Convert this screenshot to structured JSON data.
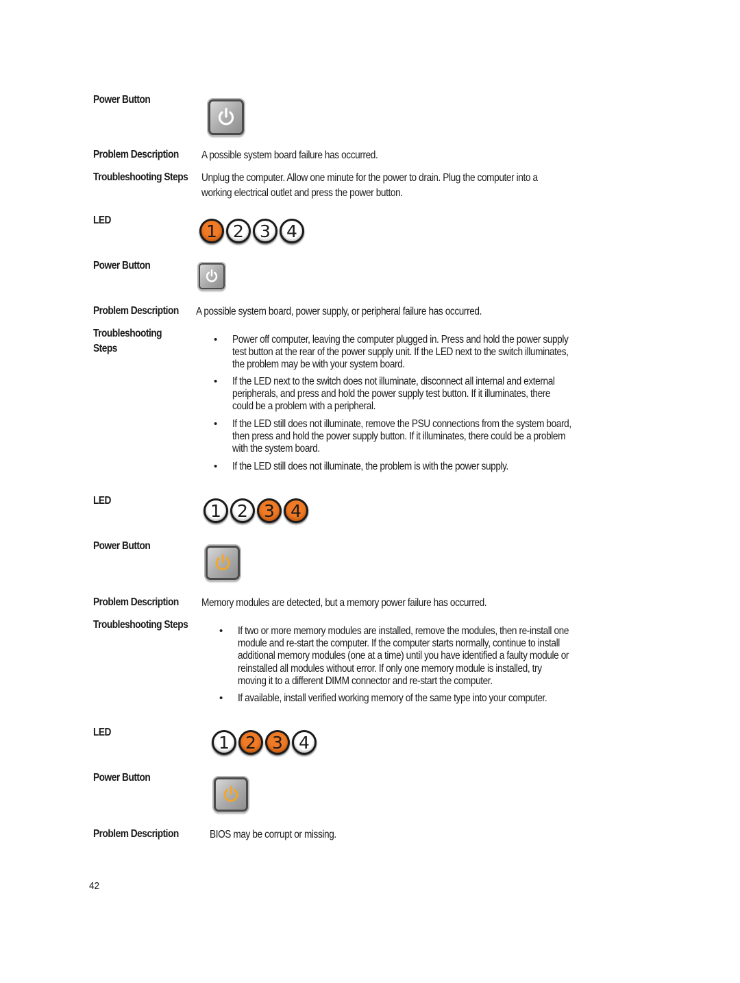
{
  "sections": [
    {
      "power_button_label": "Power Button",
      "power_button_state": "white",
      "problem_label": "Problem Description",
      "problem_text": "A possible system board failure has occurred.",
      "steps_label": "Troubleshooting Steps",
      "steps_lines": [
        "Unplug the computer. Allow one minute for the power to drain. Plug the computer into a",
        "working electrical outlet and press the power button."
      ]
    },
    {
      "led_label": "LED",
      "leds": [
        {
          "number": "1",
          "on": true
        },
        {
          "number": "2",
          "on": false
        },
        {
          "number": "3",
          "on": false
        },
        {
          "number": "4",
          "on": false
        }
      ],
      "power_button_label": "Power Button",
      "power_button_state": "white",
      "problem_label": "Problem Description",
      "problem_text": "A possible system board, power supply, or peripheral failure has occurred.",
      "steps_label_line1": "Troubleshooting",
      "steps_label_line2": "Steps",
      "steps": [
        [
          "Power off computer, leaving the computer plugged in. Press and hold the power supply",
          "test button at the rear of the power supply unit. If the LED next to the switch illuminates,",
          "the problem may be with your system board."
        ],
        [
          "If the LED next to the switch does not illuminate, disconnect all internal and external",
          "peripherals, and press and hold the power supply test button. If it illuminates, there",
          "could be a problem with a peripheral."
        ],
        [
          "If the LED still does not illuminate, remove the PSU connections from the system board,",
          "then press and hold the power supply button. If it illuminates, there could be a problem",
          "with the system board."
        ],
        [
          "If the LED still does not illuminate, the problem is with the power supply."
        ]
      ]
    },
    {
      "led_label": "LED",
      "leds": [
        {
          "number": "1",
          "on": false
        },
        {
          "number": "2",
          "on": false
        },
        {
          "number": "3",
          "on": true
        },
        {
          "number": "4",
          "on": true
        }
      ],
      "power_button_label": "Power Button",
      "power_button_state": "amber",
      "problem_label": "Problem Description",
      "problem_text": "Memory modules are detected, but a memory power failure has occurred.",
      "steps_label": "Troubleshooting Steps",
      "steps": [
        [
          "If two or more memory modules are installed, remove the modules, then re-install one",
          "module and re-start the computer. If the computer starts normally, continue to install",
          "additional memory modules (one at a time) until you have identified a faulty module or",
          "reinstalled all modules without error. If only one memory module is installed, try",
          "moving it to a different DIMM connector and re-start the computer."
        ],
        [
          "If available, install verified working memory of the same type into your computer."
        ]
      ]
    },
    {
      "led_label": "LED",
      "leds": [
        {
          "number": "1",
          "on": false
        },
        {
          "number": "2",
          "on": true
        },
        {
          "number": "3",
          "on": true
        },
        {
          "number": "4",
          "on": false
        }
      ],
      "power_button_label": "Power Button",
      "power_button_state": "amber",
      "problem_label": "Problem Description",
      "problem_text": "BIOS may be corrupt or missing."
    }
  ],
  "bullet_glyph": "•",
  "colors": {
    "led_on": "#f07a25",
    "power_white": "#ffffff",
    "power_amber": "#f5a623"
  },
  "page_number": "42"
}
